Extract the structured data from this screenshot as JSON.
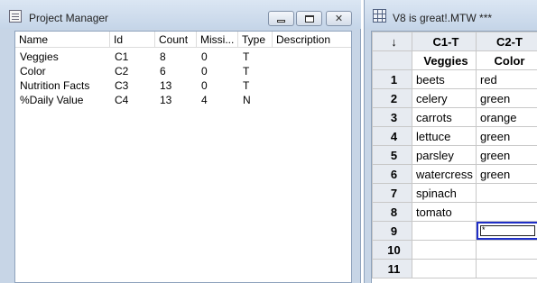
{
  "project_manager": {
    "title": "Project Manager",
    "columns": [
      "Name",
      "Id",
      "Count",
      "Missi...",
      "Type",
      "Description"
    ],
    "rows": [
      {
        "name": "Veggies",
        "id": "C1",
        "count": "8",
        "missing": "0",
        "type": "T",
        "description": ""
      },
      {
        "name": "Color",
        "id": "C2",
        "count": "6",
        "missing": "0",
        "type": "T",
        "description": ""
      },
      {
        "name": "Nutrition Facts",
        "id": "C3",
        "count": "13",
        "missing": "0",
        "type": "T",
        "description": ""
      },
      {
        "name": "%Daily Value",
        "id": "C4",
        "count": "13",
        "missing": "4",
        "type": "N",
        "description": ""
      }
    ],
    "buttons": {
      "minimize_icon": "minimize-icon",
      "maximize_icon": "maximize-icon",
      "close_glyph": "✕"
    }
  },
  "worksheet": {
    "title": "V8 is great!.MTW ***",
    "corner_glyph": "↓",
    "column_ids": [
      "C1-T",
      "C2-T"
    ],
    "column_names": [
      "Veggies",
      "Color"
    ],
    "rows": [
      {
        "num": "1",
        "c1": "beets",
        "c2": "red"
      },
      {
        "num": "2",
        "c1": "celery",
        "c2": "green"
      },
      {
        "num": "3",
        "c1": "carrots",
        "c2": "orange"
      },
      {
        "num": "4",
        "c1": "lettuce",
        "c2": "green"
      },
      {
        "num": "5",
        "c1": "parsley",
        "c2": "green"
      },
      {
        "num": "6",
        "c1": "watercress",
        "c2": "green"
      },
      {
        "num": "7",
        "c1": "spinach",
        "c2": ""
      },
      {
        "num": "8",
        "c1": "tomato",
        "c2": ""
      },
      {
        "num": "9",
        "c1": "",
        "c2": "*"
      },
      {
        "num": "10",
        "c1": "",
        "c2": ""
      },
      {
        "num": "11",
        "c1": "",
        "c2": ""
      }
    ],
    "active_cell": {
      "row": "9",
      "column": "C2-T"
    },
    "active_border_color": "#1f2ec7"
  }
}
